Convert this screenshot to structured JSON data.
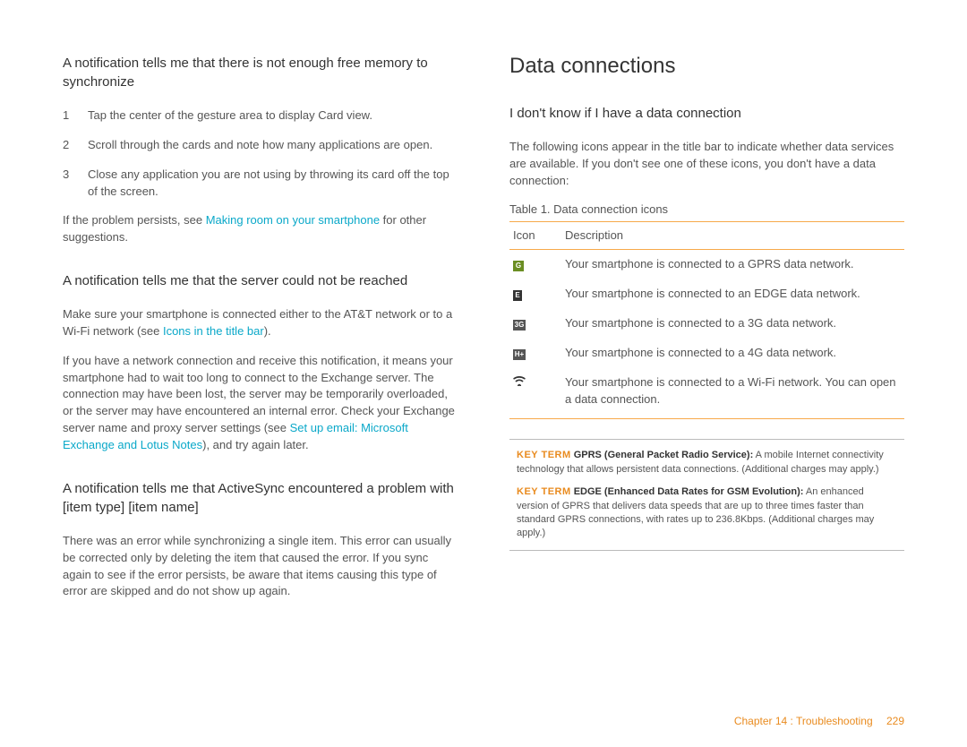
{
  "left": {
    "sec1": {
      "h": "A notification tells me that there is not enough free memory to synchronize",
      "steps": [
        "Tap the center of the gesture area to display Card view.",
        "Scroll through the cards and note how many applications are open.",
        "Close any application you are not using by throwing its card off the top of the screen."
      ],
      "p1a": "If the problem persists, see ",
      "p1link": "Making room on your smartphone",
      "p1b": " for other suggestions."
    },
    "sec2": {
      "h": "A notification tells me that the server could not be reached",
      "p1a": "Make sure your smartphone is connected either to the AT&T network or to a Wi-Fi network (see ",
      "p1link": "Icons in the title bar",
      "p1b": ").",
      "p2a": "If you have a network connection and receive this notification, it means your smartphone had to wait too long to connect to the Exchange server. The connection may have been lost, the server may be temporarily overloaded, or the server may have encountered an internal error. Check your Exchange server name and proxy server settings (see ",
      "p2link": "Set up email: Microsoft Exchange and Lotus Notes",
      "p2b": "), and try again later."
    },
    "sec3": {
      "h": "A notification tells me that ActiveSync encountered a problem with [item type] [item name]",
      "p1": "There was an error while synchronizing a single item. This error can usually be corrected only by deleting the item that caused the error. If you sync again to see if the error persists, be aware that items causing this type of error are skipped and do not show up again."
    }
  },
  "right": {
    "h1": "Data connections",
    "sec1": {
      "h": "I don't know if I have a data connection",
      "p1": "The following icons appear in the title bar to indicate whether data services are available. If you don't see one of these icons, you don't have a data connection:",
      "tableCaption": "Table 1.  Data connection icons",
      "thIcon": "Icon",
      "thDesc": "Description",
      "rows": [
        {
          "icon": "gprs",
          "glyph": "G",
          "desc": "Your smartphone is connected to a GPRS data network."
        },
        {
          "icon": "edge",
          "glyph": "E",
          "desc": "Your smartphone is connected to an EDGE data network."
        },
        {
          "icon": "g3",
          "glyph": "3G",
          "desc": "Your smartphone is connected to a 3G data network."
        },
        {
          "icon": "g4",
          "glyph": "H+",
          "desc": "Your smartphone is connected to a 4G data network."
        },
        {
          "icon": "wifi",
          "glyph": "",
          "desc": "Your smartphone is connected to a Wi-Fi network. You can open a data connection."
        }
      ],
      "kt1label": "KEY TERM",
      "kt1term": "GPRS (General Packet Radio Service):",
      "kt1body": " A mobile Internet connectivity technology that allows persistent data connections. (Additional charges may apply.)",
      "kt2label": "KEY TERM",
      "kt2term": "EDGE (Enhanced Data Rates for GSM Evolution):",
      "kt2body": " An enhanced version of GPRS that delivers data speeds that are up to three times faster than standard GPRS connections, with rates up to 236.8Kbps. (Additional charges may apply.)"
    }
  },
  "footer": {
    "chapter": "Chapter 14 : Troubleshooting",
    "page": "229"
  }
}
